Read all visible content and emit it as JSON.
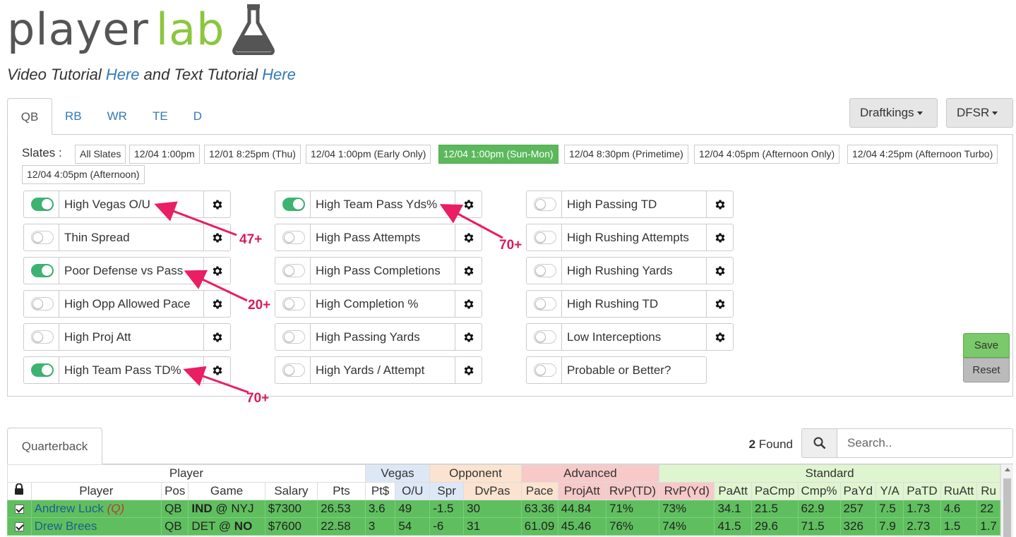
{
  "logo": {
    "part1": "player",
    "part2": "lab",
    "flask_icon": "flask-icon"
  },
  "subtitle": {
    "t1": "Video Tutorial ",
    "link1": "Here",
    "t2": " and Text Tutorial ",
    "link2": "Here"
  },
  "position_tabs": [
    "QB",
    "RB",
    "WR",
    "TE",
    "D"
  ],
  "active_position": "QB",
  "site_dropdown": "Draftkings",
  "source_dropdown": "DFSR",
  "slates_label": "Slates :",
  "slates": [
    "All Slates",
    "12/04 1:00pm",
    "12/01 8:25pm (Thu)",
    "12/04 1:00pm (Early Only)",
    "12/04 1:00pm (Sun-Mon)",
    "12/04 8:30pm (Primetime)",
    "12/04 4:05pm (Afternoon Only)",
    "12/04 4:25pm (Afternoon Turbo)",
    "12/04 4:05pm (Afternoon)"
  ],
  "active_slate": "12/04 1:00pm (Sun-Mon)",
  "filters": [
    {
      "label": "High Vegas O/U",
      "on": true
    },
    {
      "label": "Thin Spread",
      "on": false
    },
    {
      "label": "Poor Defense vs Pass",
      "on": true
    },
    {
      "label": "High Opp Allowed Pace",
      "on": false
    },
    {
      "label": "High Proj Att",
      "on": false
    },
    {
      "label": "High Team Pass TD%",
      "on": true
    },
    {
      "label": "High Team Pass Yds%",
      "on": true
    },
    {
      "label": "High Pass Attempts",
      "on": false
    },
    {
      "label": "High Pass Completions",
      "on": false
    },
    {
      "label": "High Completion %",
      "on": false
    },
    {
      "label": "High Passing Yards",
      "on": false
    },
    {
      "label": "High Yards / Attempt",
      "on": false
    },
    {
      "label": "High Passing TD",
      "on": false
    },
    {
      "label": "High Rushing Attempts",
      "on": false
    },
    {
      "label": "High Rushing Yards",
      "on": false
    },
    {
      "label": "High Rushing TD",
      "on": false
    },
    {
      "label": "Low Interceptions",
      "on": false
    },
    {
      "label": "Probable or Better?",
      "on": false
    }
  ],
  "annotations": [
    "47+",
    "70+",
    "20+",
    "70+"
  ],
  "buttons": {
    "save": "Save",
    "reset": "Reset"
  },
  "table_tab": "Quarterback",
  "found": {
    "count": "2",
    "label": " Found"
  },
  "search_placeholder": "Search..",
  "table": {
    "groups": [
      "Player",
      "Vegas",
      "Opponent",
      "Advanced",
      "Standard"
    ],
    "columns": [
      "Player",
      "Pos",
      "Game",
      "Salary",
      "Pts",
      "Pt$",
      "O/U",
      "Spr",
      "DvPas",
      "Pace",
      "ProjAtt",
      "RvP(TD)",
      "RvP(Yd)",
      "PaAtt",
      "PaCmp",
      "Cmp%",
      "PaYd",
      "Y/A",
      "PaTD",
      "RuAtt",
      "Ru"
    ],
    "rows": [
      {
        "player": "Andrew Luck",
        "tag": "(Q)",
        "pos": "QB",
        "team": "IND",
        "sep": " @ ",
        "opp": "NYJ",
        "bold": "team",
        "salary": "$7300",
        "pts": "26.53",
        "ptd": "3.6",
        "ou": "49",
        "spr": "-1.5",
        "dvpas": "30",
        "pace": "63.36",
        "projatt": "44.84",
        "rvptd": "71%",
        "rvpyd": "73%",
        "paatt": "34.1",
        "pacmp": "21.5",
        "cmp": "62.9",
        "payd": "257",
        "ya": "7.5",
        "patd": "1.73",
        "ruatt": "4.6",
        "ru": "22"
      },
      {
        "player": "Drew Brees",
        "tag": "",
        "pos": "QB",
        "team": "DET",
        "sep": " @ ",
        "opp": "NO",
        "bold": "opp",
        "salary": "$7600",
        "pts": "22.58",
        "ptd": "3",
        "ou": "54",
        "spr": "-6",
        "dvpas": "31",
        "pace": "61.09",
        "projatt": "45.46",
        "rvptd": "76%",
        "rvpyd": "74%",
        "paatt": "41.5",
        "pacmp": "29.6",
        "cmp": "71.5",
        "payd": "326",
        "ya": "7.9",
        "patd": "2.73",
        "ruatt": "1.5",
        "ru": "1.7"
      }
    ]
  },
  "colors": {
    "green": "#5cb85c",
    "accent": "#8cc63f",
    "link": "#337ab7",
    "annotation": "#d81b60"
  }
}
